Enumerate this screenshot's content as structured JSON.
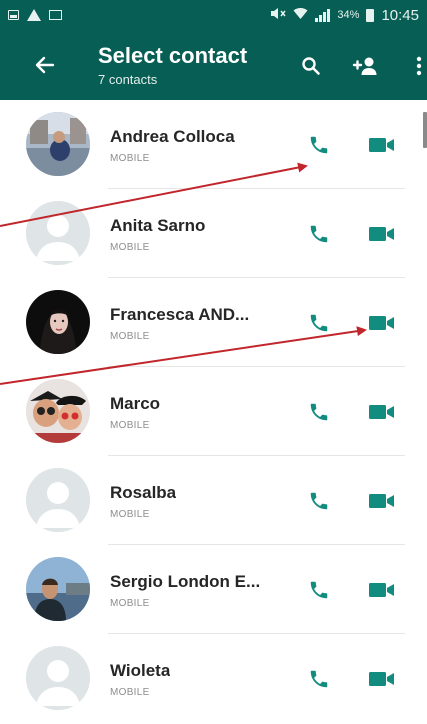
{
  "status_bar": {
    "battery_pct": "34%",
    "time": "10:45"
  },
  "app_bar": {
    "title": "Select contact",
    "subtitle": "7 contacts"
  },
  "icons": {
    "back": "arrow-left-icon",
    "search": "search-icon",
    "add_contact": "person-add-icon",
    "more": "more-vert-icon",
    "call": "phone-icon",
    "video": "video-camera-icon"
  },
  "colors": {
    "primary_dark": "#075e54",
    "accent_icon": "#128c7e",
    "annotation_arrow": "#c0262b"
  },
  "contacts": [
    {
      "name": "Andrea Colloca",
      "type": "MOBILE",
      "avatar": "photo"
    },
    {
      "name": "Anita Sarno",
      "type": "MOBILE",
      "avatar": "default"
    },
    {
      "name": "Francesca AND...",
      "type": "MOBILE",
      "avatar": "photo"
    },
    {
      "name": "Marco",
      "type": "MOBILE",
      "avatar": "photo"
    },
    {
      "name": "Rosalba",
      "type": "MOBILE",
      "avatar": "default"
    },
    {
      "name": "Sergio London E...",
      "type": "MOBILE",
      "avatar": "photo"
    },
    {
      "name": "Wioleta",
      "type": "MOBILE",
      "avatar": "default"
    }
  ]
}
